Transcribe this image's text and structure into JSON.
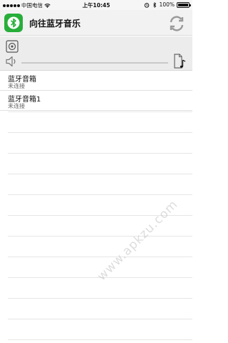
{
  "status_bar": {
    "carrier": "中国电信",
    "time": "上午10:45",
    "battery": "100%"
  },
  "header": {
    "title": "向往蓝牙音乐",
    "logo_icon": "bluetooth-icon",
    "refresh_icon": "refresh-icon",
    "accent_color": "#27ae3a"
  },
  "player": {
    "speaker_icon": "speaker-icon",
    "volume_icon": "volume-icon",
    "music_icon": "music-file-icon",
    "volume_level": 0
  },
  "devices": [
    {
      "name": "蓝牙音箱",
      "status": "未连接"
    },
    {
      "name": "蓝牙音箱1",
      "status": "未连接"
    }
  ],
  "watermark": "www.apkzu.com"
}
